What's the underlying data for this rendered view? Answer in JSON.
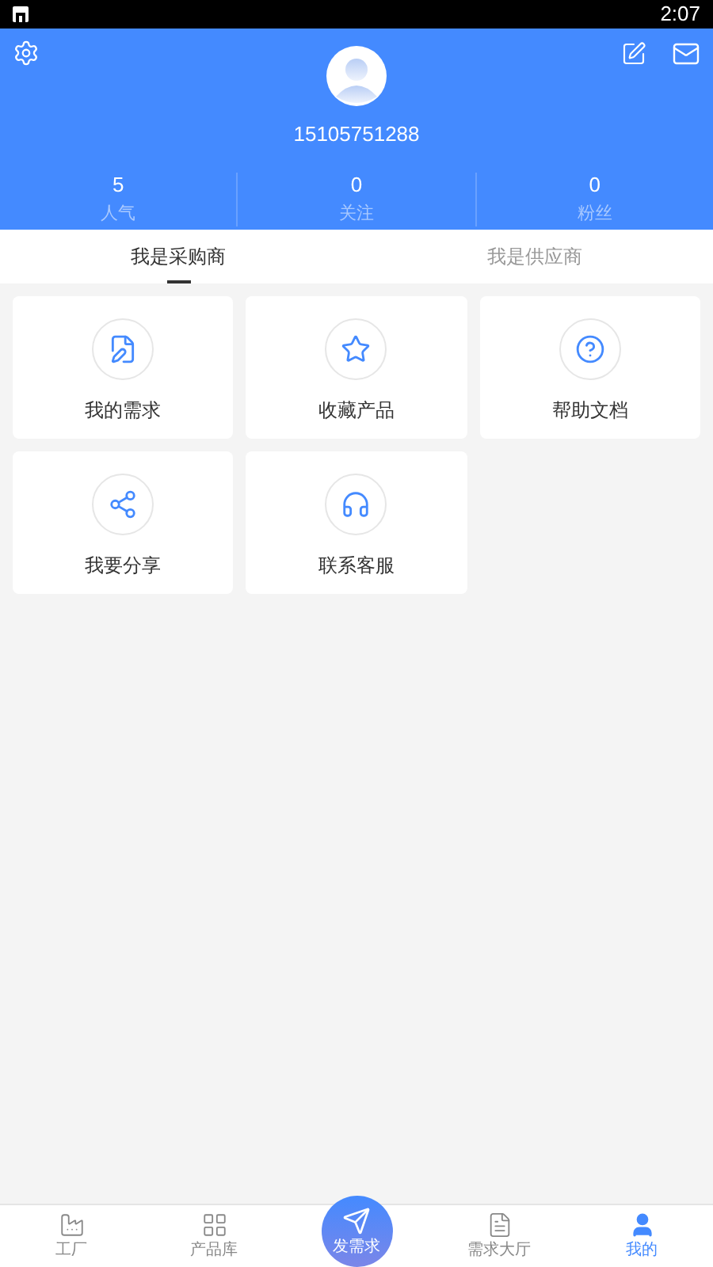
{
  "status_bar": {
    "time": "2:07"
  },
  "profile": {
    "phone": "15105751288"
  },
  "stats": [
    {
      "value": "5",
      "label": "人气"
    },
    {
      "value": "0",
      "label": "关注"
    },
    {
      "value": "0",
      "label": "粉丝"
    }
  ],
  "tabs": [
    {
      "label": "我是采购商",
      "selected": true
    },
    {
      "label": "我是供应商",
      "selected": false
    }
  ],
  "menu": [
    {
      "kind": "demand",
      "label": "我的需求"
    },
    {
      "kind": "favorite",
      "label": "收藏产品"
    },
    {
      "kind": "help",
      "label": "帮助文档"
    },
    {
      "kind": "share",
      "label": "我要分享"
    },
    {
      "kind": "service",
      "label": "联系客服"
    }
  ],
  "bottom_nav": [
    {
      "kind": "factory",
      "label": "工厂",
      "selected": false
    },
    {
      "kind": "products",
      "label": "产品库",
      "selected": false
    },
    {
      "kind": "post",
      "label": "发需求",
      "selected": false
    },
    {
      "kind": "hall",
      "label": "需求大厅",
      "selected": false
    },
    {
      "kind": "me",
      "label": "我的",
      "selected": true
    }
  ]
}
